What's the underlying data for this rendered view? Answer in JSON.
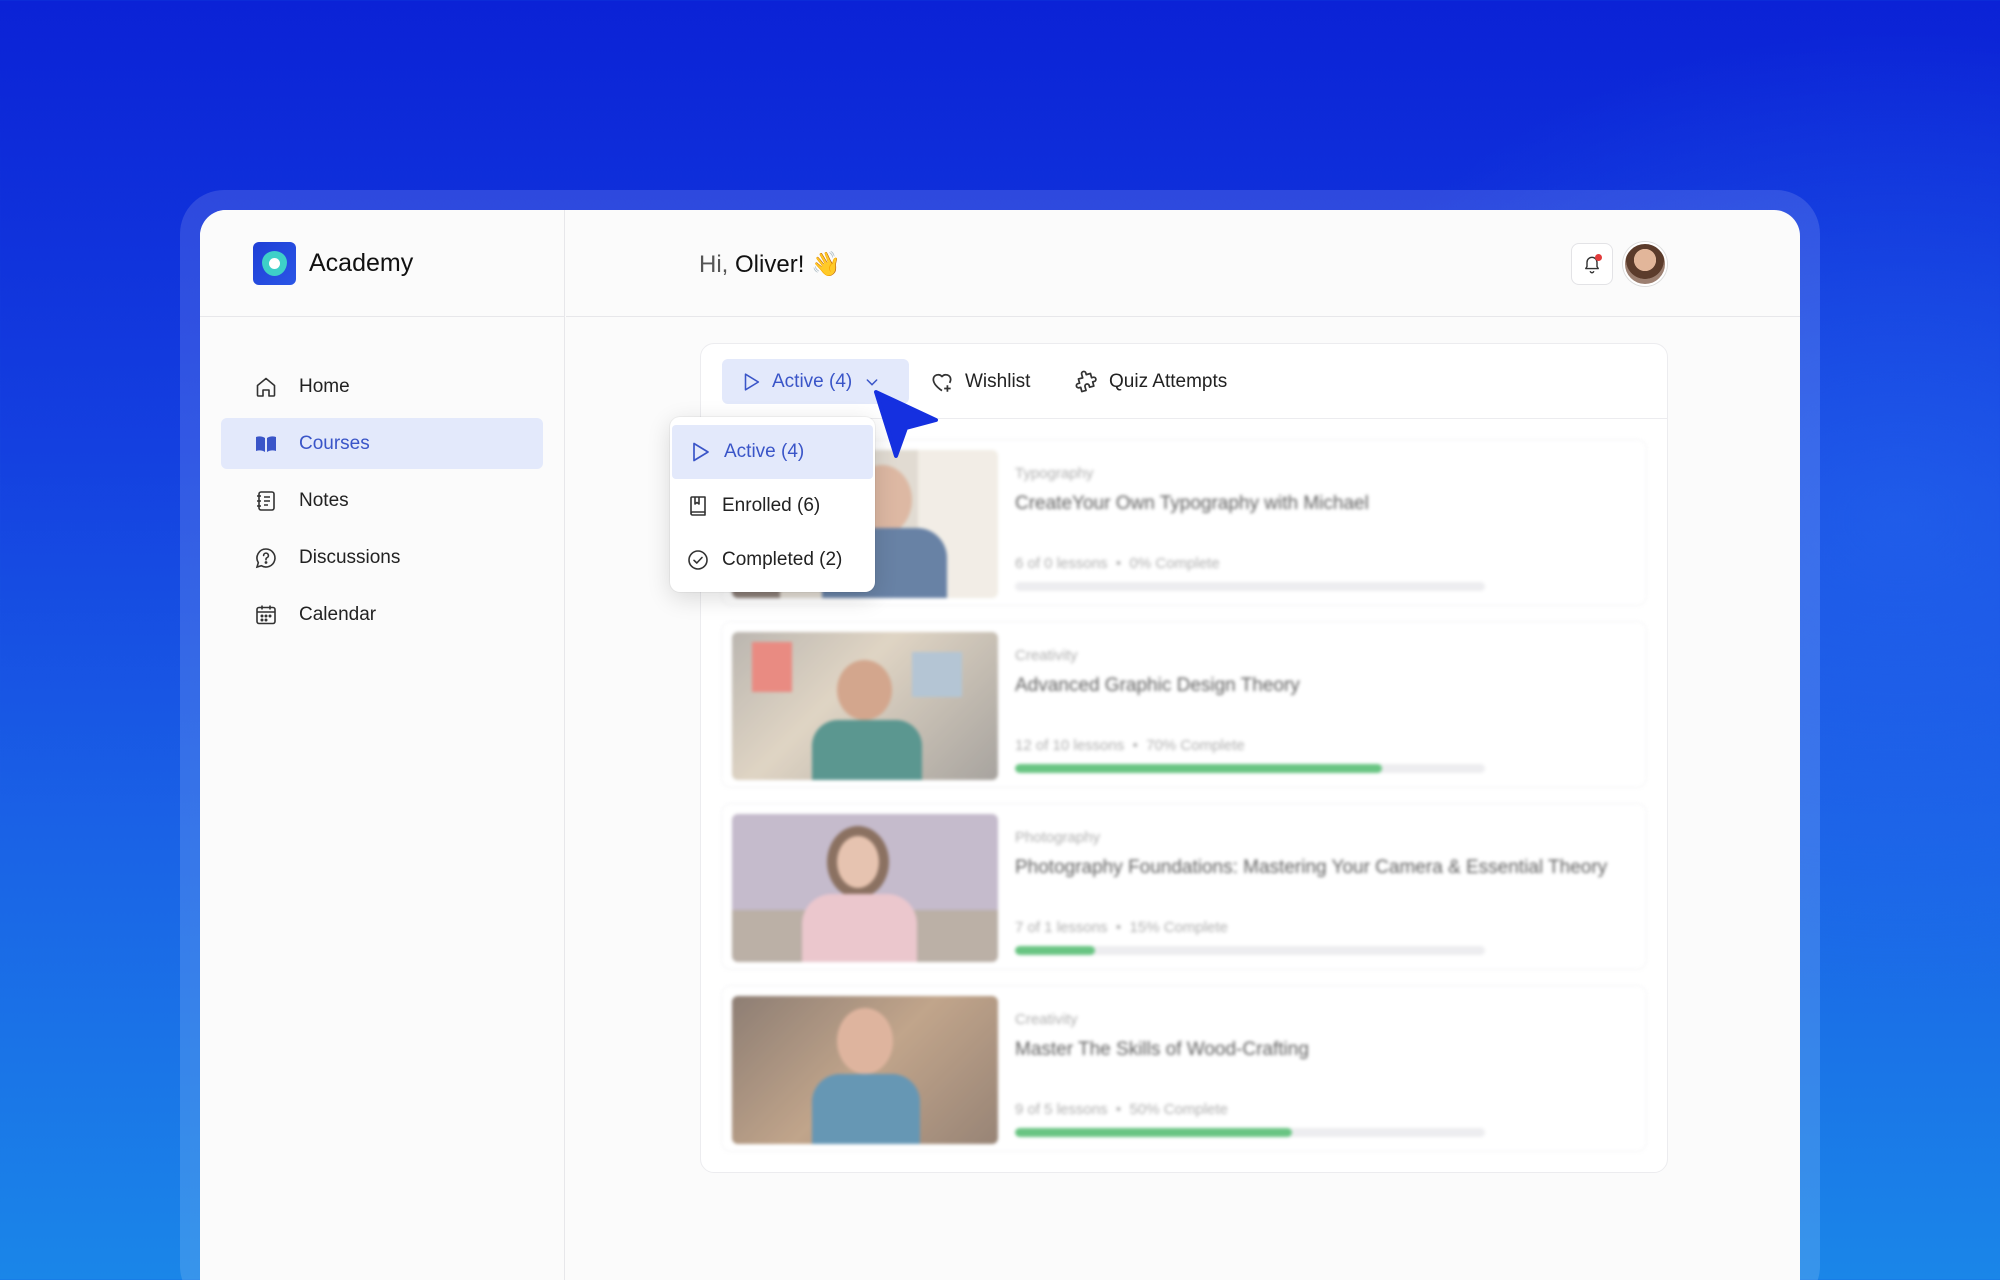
{
  "brand": {
    "name": "Academy"
  },
  "sidebar": {
    "items": [
      {
        "label": "Home",
        "icon": "home-icon",
        "active": false
      },
      {
        "label": "Courses",
        "icon": "book-icon",
        "active": true
      },
      {
        "label": "Notes",
        "icon": "notes-icon",
        "active": false
      },
      {
        "label": "Discussions",
        "icon": "question-bubble-icon",
        "active": false
      },
      {
        "label": "Calendar",
        "icon": "calendar-icon",
        "active": false
      }
    ]
  },
  "header": {
    "greeting_prefix": "Hi,",
    "user_name": "Oliver!",
    "emoji": "👋",
    "notifications_unread": true
  },
  "tabs": {
    "active_label": "Active (4)",
    "wishlist_label": "Wishlist",
    "quiz_label": "Quiz Attempts"
  },
  "dropdown": {
    "options": [
      {
        "label": "Active (4)",
        "icon": "play-icon",
        "selected": true
      },
      {
        "label": "Enrolled (6)",
        "icon": "bookmark-book-icon",
        "selected": false
      },
      {
        "label": "Completed (2)",
        "icon": "check-circle-icon",
        "selected": false
      }
    ]
  },
  "courses": [
    {
      "category": "Typography",
      "title": "CreateYour Own Typography with Michael",
      "lessons": "6 of 0 lessons",
      "complete": "0% Complete",
      "progress": 0
    },
    {
      "category": "Creativity",
      "title": "Advanced Graphic Design Theory",
      "lessons": "12 of 10 lessons",
      "complete": "70% Complete",
      "progress": 0.78
    },
    {
      "category": "Photography",
      "title": "Photography Foundations: Mastering Your Camera & Essential Theory",
      "lessons": "7 of 1 lessons",
      "complete": "15% Complete",
      "progress": 0.17
    },
    {
      "category": "Creativity",
      "title": "Master The Skills of Wood-Crafting",
      "lessons": "9 of 5 lessons",
      "complete": "50% Complete",
      "progress": 0.59
    }
  ],
  "separator": "•",
  "colors": {
    "accent": "#3a55c8",
    "accent_bg": "#e3e9fb",
    "progress": "#3fb560",
    "cursor": "#1530e0"
  }
}
